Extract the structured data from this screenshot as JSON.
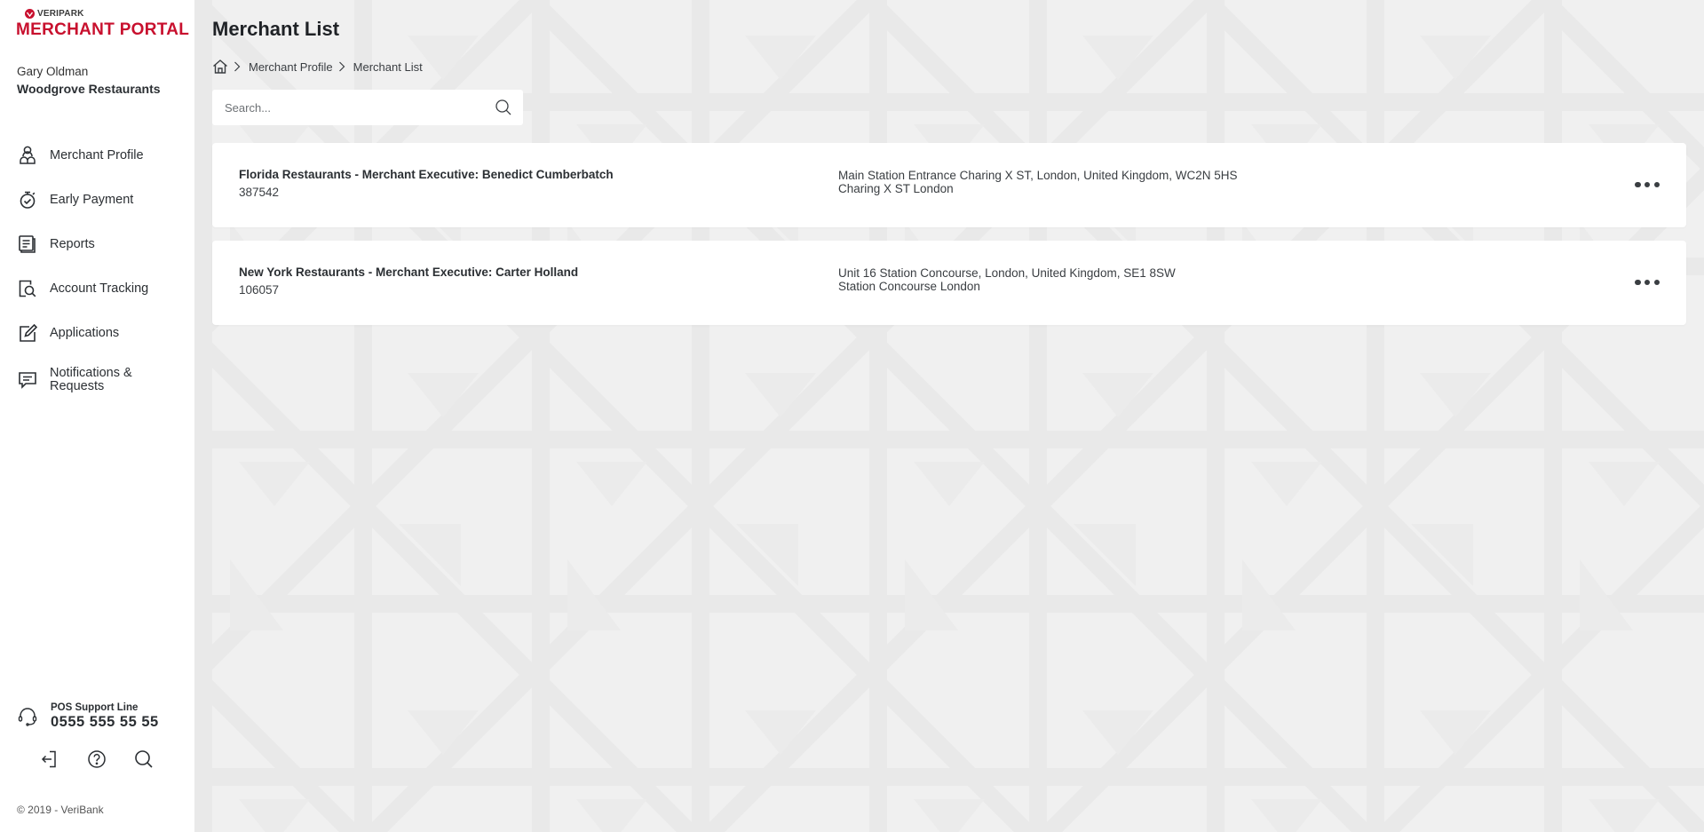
{
  "brand": {
    "company": "VERIPARK",
    "product": "MERCHANT PORTAL",
    "accent_color": "#c8102e"
  },
  "user": {
    "name": "Gary Oldman",
    "company": "Woodgrove Restaurants"
  },
  "sidebar": {
    "items": [
      {
        "label": "Merchant Profile",
        "icon": "merchant-profile-icon"
      },
      {
        "label": "Early Payment",
        "icon": "stopwatch-icon"
      },
      {
        "label": "Reports",
        "icon": "reports-icon"
      },
      {
        "label": "Account Tracking",
        "icon": "account-tracking-icon"
      },
      {
        "label": "Applications",
        "icon": "edit-icon"
      },
      {
        "label": "Notifications &\nRequests",
        "label_line1": "Notifications &",
        "label_line2": "Requests",
        "icon": "chat-icon"
      }
    ],
    "support": {
      "title": "POS Support Line",
      "phone": "0555 555 55 55"
    },
    "tools": [
      {
        "name": "logout",
        "icon": "logout-icon"
      },
      {
        "name": "help",
        "icon": "help-icon"
      },
      {
        "name": "search",
        "icon": "search-icon"
      }
    ],
    "copyright": "© 2019 - VeriBank"
  },
  "page": {
    "title": "Merchant List",
    "breadcrumb": [
      "Merchant Profile",
      "Merchant List"
    ],
    "search": {
      "placeholder": "Search...",
      "value": ""
    }
  },
  "merchants": [
    {
      "title": "Florida Restaurants - Merchant Executive: Benedict Cumberbatch",
      "id": "387542",
      "address_line1": "Main Station Entrance Charing X ST, London, United Kingdom, WC2N 5HS",
      "address_line2": "Charing X ST London"
    },
    {
      "title": "New York Restaurants - Merchant Executive: Carter Holland",
      "id": "106057",
      "address_line1": "Unit 16 Station Concourse, London, United Kingdom, SE1 8SW",
      "address_line2": "Station Concourse London"
    }
  ]
}
